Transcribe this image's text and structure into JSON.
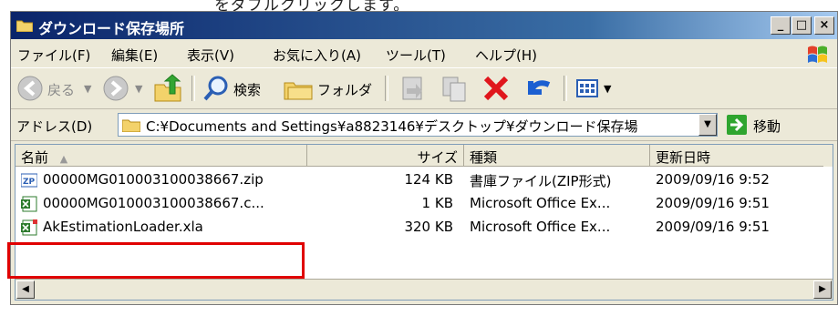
{
  "caption": "をダブルクリックします。",
  "window": {
    "title": "ダウンロード保存場所",
    "controls": {
      "minimize": "_",
      "maximize": "□",
      "close": "×"
    }
  },
  "menu": [
    "ファイル(F)",
    "編集(E)",
    "表示(V)",
    "お気に入り(A)",
    "ツール(T)",
    "ヘルプ(H)"
  ],
  "toolbar": {
    "back_label": "戻る",
    "search_label": "検索",
    "folders_label": "フォルダ"
  },
  "address": {
    "label": "アドレス(D)",
    "value": "C:¥Documents and Settings¥a8823146¥デスクトップ¥ダウンロード保存場",
    "go_label": "移動"
  },
  "columns": {
    "name": "名前",
    "size": "サイズ",
    "type": "種類",
    "date": "更新日時"
  },
  "files": [
    {
      "name": "00000MG010003100038667.zip",
      "size": "124 KB",
      "type": "書庫ファイル(ZIP形式)",
      "date": "2009/09/16 9:52",
      "icon": "zip-file-icon"
    },
    {
      "name": "00000MG010003100038667.c...",
      "size": "1 KB",
      "type": "Microsoft Office Ex...",
      "date": "2009/09/16 9:51",
      "icon": "excel-csv-icon"
    },
    {
      "name": "AkEstimationLoader.xla",
      "size": "320 KB",
      "type": "Microsoft Office Ex...",
      "date": "2009/09/16 9:51",
      "icon": "excel-addin-icon"
    }
  ],
  "colors": {
    "highlight": "#e00000",
    "titlebar": "#0a246a"
  }
}
